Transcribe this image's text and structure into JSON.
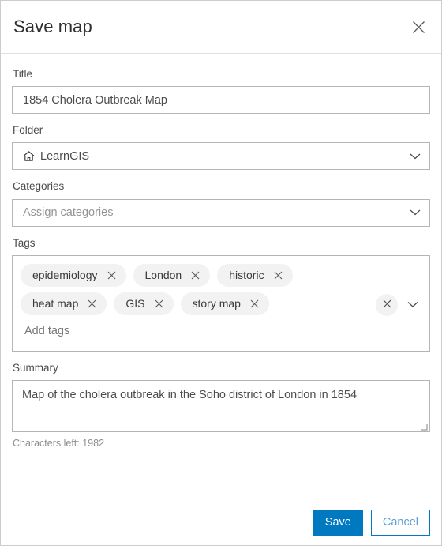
{
  "dialog": {
    "title": "Save map",
    "close_icon": "close-icon"
  },
  "form": {
    "title_field": {
      "label": "Title",
      "value": "1854 Cholera Outbreak Map"
    },
    "folder_field": {
      "label": "Folder",
      "value": "LearnGIS",
      "icon": "home-icon",
      "chevron_icon": "chevron-down-icon"
    },
    "categories_field": {
      "label": "Categories",
      "value": "",
      "placeholder": "Assign categories",
      "chevron_icon": "chevron-down-icon"
    },
    "tags_field": {
      "label": "Tags",
      "placeholder": "Add tags",
      "value": "",
      "tags": [
        "epidemiology",
        "London",
        "historic",
        "heat map",
        "GIS",
        "story map"
      ],
      "remove_icon": "close-icon",
      "clear_all_icon": "close-circle-icon",
      "chevron_icon": "chevron-down-icon"
    },
    "summary_field": {
      "label": "Summary",
      "value": "Map of the cholera outbreak in the Soho district of London in 1854",
      "characters_left": "Characters left: 1982",
      "resize_icon": "resize-grip-icon"
    }
  },
  "footer": {
    "save_label": "Save",
    "cancel_label": "Cancel"
  },
  "colors": {
    "accent": "#0079c1",
    "border": "#b5b5b5",
    "tag_background": "#f2f2f2",
    "text": "#4c4c4c",
    "placeholder": "#949494"
  }
}
